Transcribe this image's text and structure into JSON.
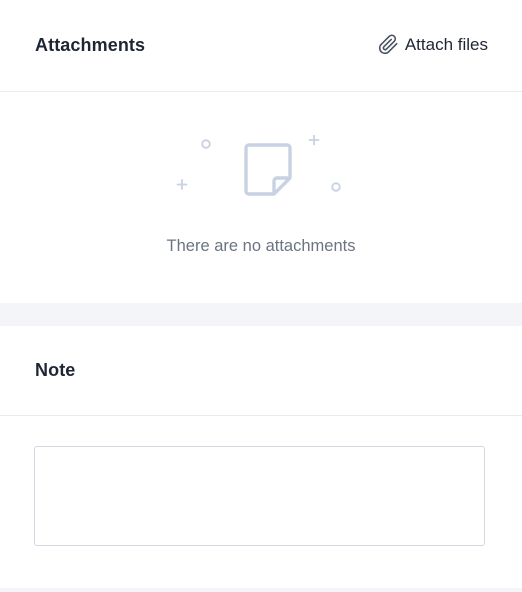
{
  "attachments": {
    "title": "Attachments",
    "attach_label": "Attach files",
    "attach_icon": "paperclip-icon",
    "empty_icon": "document-icon",
    "empty_text": "There are no attachments"
  },
  "note": {
    "title": "Note",
    "value": "",
    "placeholder": ""
  },
  "colors": {
    "accent_icon": "#c9d2e3",
    "text_primary": "#1f2633",
    "text_muted": "#6b7482",
    "page_bg": "#f3f5f9"
  }
}
